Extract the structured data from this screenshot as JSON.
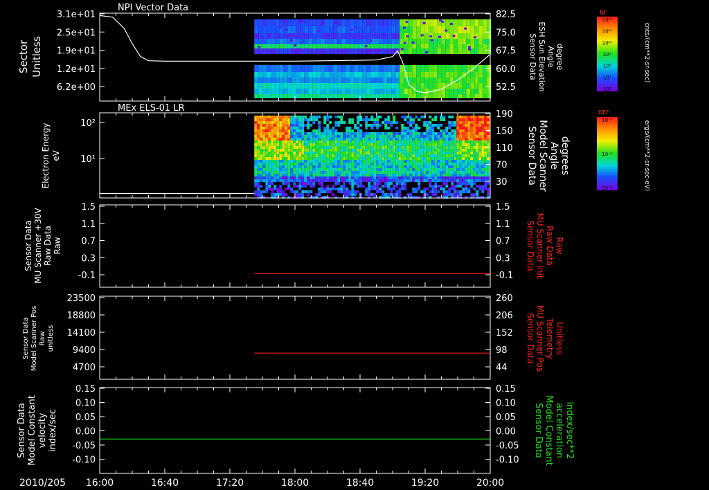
{
  "colors": {
    "background": "#000000",
    "axis": "#ffffff",
    "red_trace": "#ff2020",
    "green_trace": "#20e020",
    "white_trace": "#ffffff"
  },
  "time_axis": {
    "date_label": "2010/205",
    "start": "16:00",
    "end": "20:00",
    "tick_labels": [
      "16:00",
      "16:40",
      "17:20",
      "18:00",
      "18:40",
      "19:20",
      "20:00"
    ]
  },
  "chart_data": [
    {
      "type": "heatmap",
      "title": "NPI Vector Data",
      "ylabel_left": [
        "Sector",
        "Unitless"
      ],
      "ylabel_right": [
        "Sensor Data",
        "ESH Sun Elevation",
        "Angle",
        "degree"
      ],
      "yticks_left": [
        "3.1e+01",
        "2.5e+01",
        "1.9e+01",
        "1.2e+01",
        "6.2e+00"
      ],
      "yticks_right": [
        "82.5",
        "75.0",
        "67.5",
        "60.0",
        "52.5"
      ],
      "right_ylim": [
        45,
        82.5
      ],
      "data_start": "17:35",
      "overlay_line": {
        "name": "",
        "x": [
          "16:00",
          "16:08",
          "16:15",
          "16:20",
          "16:25",
          "16:30",
          "16:40",
          "17:00",
          "18:00",
          "18:50",
          "19:00",
          "19:03",
          "19:06",
          "19:10",
          "19:15",
          "19:20",
          "19:30",
          "19:40",
          "19:50",
          "20:00"
        ],
        "y": [
          81.5,
          80.8,
          76,
          69.5,
          64,
          62.2,
          62,
          62,
          62,
          62.5,
          64,
          66.4,
          62,
          52,
          49.2,
          48.5,
          50,
          54,
          59,
          65
        ]
      },
      "colorbar": {
        "title": "NF",
        "units": "cnts/(cm**2-sr-sec)",
        "tick_labels": [
          "10¹²",
          "10¹¹",
          "10¹⁰",
          "10⁹",
          "10⁸",
          "10⁷",
          "10⁶"
        ]
      }
    },
    {
      "type": "heatmap",
      "title": "MEx ELS-01 LR",
      "ylabel_left": [
        "Electron Energy",
        "eV"
      ],
      "ylabel_right": [
        "Sensor Data",
        "Model Scanner",
        "Angle",
        "degrees"
      ],
      "yticks_left": [
        "10²",
        "10¹"
      ],
      "yticks_right": [
        "190",
        "150",
        "110",
        "70",
        "30"
      ],
      "data_start": "17:35",
      "overlay_line": {
        "name": "",
        "x": [
          "16:00",
          "17:35"
        ],
        "y": [
          10,
          10
        ]
      },
      "colorbar": {
        "title": "DEF",
        "units": "ergs/(cm**2-sr-sec-eV)",
        "tick_labels": [
          "10⁻¹",
          "10⁻²",
          "10⁻³"
        ]
      }
    },
    {
      "type": "line",
      "ylabel_left": [
        "Sensor Data",
        "MU Scanner +30V",
        "Raw Data",
        "Raw"
      ],
      "ylabel_right": [
        "Sensor Data",
        "MU Scanner Init",
        "Raw Data",
        "Raw"
      ],
      "yticks_left": [
        "1.5",
        "1.1",
        "0.7",
        "0.3",
        "-0.1"
      ],
      "yticks_right": [
        "1.5",
        "1.1",
        "0.7",
        "0.3",
        "-0.1"
      ],
      "ylim": [
        -0.3,
        1.5
      ],
      "series": [
        {
          "name": "",
          "x": [
            "17:35",
            "20:00"
          ],
          "y": [
            0.0,
            0.0
          ]
        }
      ]
    },
    {
      "type": "line",
      "ylabel_left": [
        "Sensor Data",
        "Model Scanner Pos",
        "Raw",
        "unitless"
      ],
      "ylabel_right": [
        "Sensor Data",
        "MU Scanner Pos",
        "Telemetry",
        "Unitless"
      ],
      "yticks_left": [
        "23500",
        "18800",
        "14100",
        "9400",
        "4700"
      ],
      "yticks_right": [
        "260",
        "206",
        "152",
        "98",
        "44"
      ],
      "ylim": [
        0,
        23500
      ],
      "series": [
        {
          "name": "",
          "x": [
            "17:35",
            "20:00"
          ],
          "y": [
            7400,
            7400
          ]
        }
      ]
    },
    {
      "type": "line",
      "ylabel_left": [
        "Sensor Data",
        "Model Constant",
        "velocity",
        "index/sec"
      ],
      "ylabel_right": [
        "Sensor Data",
        "Model Constant",
        "acceleration",
        "index/sec**2"
      ],
      "yticks_left": [
        "0.15",
        "0.10",
        "0.05",
        "0.00",
        "-0.05",
        "-0.10"
      ],
      "yticks_right": [
        "0.15",
        "0.10",
        "0.05",
        "0.00",
        "-0.05",
        "-0.10"
      ],
      "ylim": [
        -0.1,
        0.15
      ],
      "series": [
        {
          "name": "",
          "x": [
            "16:00",
            "20:00"
          ],
          "y": [
            0.0,
            0.0
          ]
        }
      ]
    }
  ]
}
